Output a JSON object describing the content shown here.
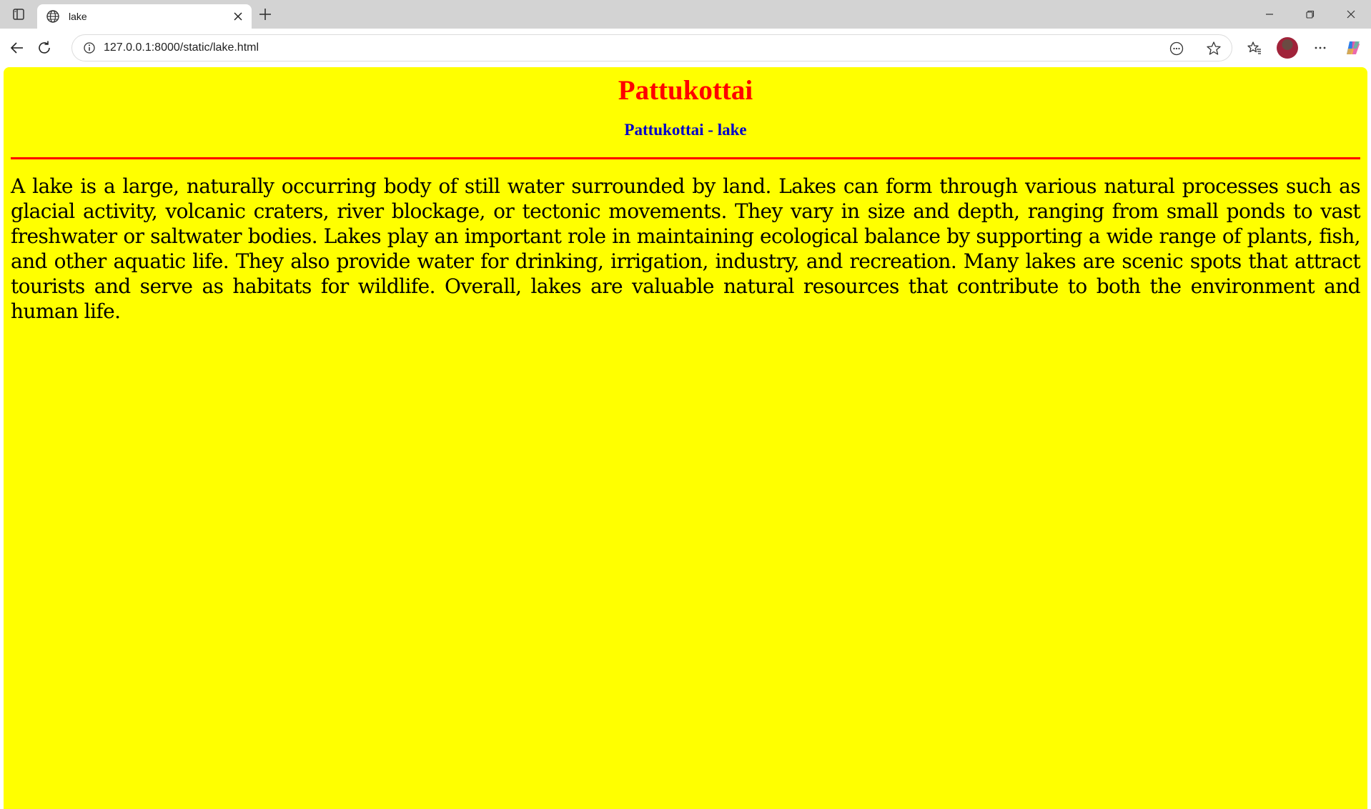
{
  "browser": {
    "tab": {
      "title": "lake",
      "icon": "globe-icon"
    },
    "address": {
      "url": "127.0.0.1:8000/static/lake.html"
    }
  },
  "page": {
    "title": "Pattukottai",
    "subtitle": "Pattukottai - lake",
    "paragraph": "A lake is a large, naturally occurring body of still water surrounded by land. Lakes can form through various natural processes such as glacial activity, volcanic craters, river blockage, or tectonic movements. They vary in size and depth, ranging from small ponds to vast freshwater or saltwater bodies. Lakes play an important role in maintaining ecological balance by supporting a wide range of plants, fish, and other aquatic life. They also provide water for drinking, irrigation, industry, and recreation. Many lakes are scenic spots that attract tourists and serve as habitats for wildlife. Overall, lakes are valuable natural resources that contribute to both the environment and human life.",
    "colors": {
      "background": "#ffff00",
      "title": "#ff0000",
      "subtitle": "#0000cc",
      "rule": "#ff0000"
    }
  }
}
